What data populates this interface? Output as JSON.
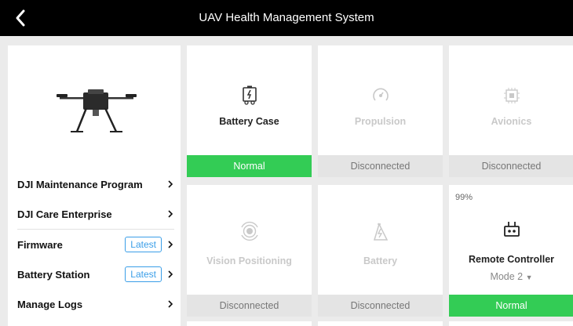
{
  "header": {
    "title": "UAV Health Management System",
    "back_icon": "chevron-left-icon"
  },
  "sidebar": {
    "items": [
      {
        "label": "DJI Maintenance Program"
      },
      {
        "label": "DJI Care Enterprise"
      },
      {
        "label": "Firmware",
        "badge": "Latest"
      },
      {
        "label": "Battery Station",
        "badge": "Latest"
      },
      {
        "label": "Manage Logs"
      }
    ]
  },
  "modules": [
    {
      "name": "Battery Case",
      "status": "Normal",
      "icon": "battery-case-icon"
    },
    {
      "name": "Propulsion",
      "status": "Disconnected",
      "icon": "propulsion-icon"
    },
    {
      "name": "Avionics",
      "status": "Disconnected",
      "icon": "avionics-icon"
    },
    {
      "name": "Vision Positioning",
      "status": "Disconnected",
      "icon": "vision-positioning-icon"
    },
    {
      "name": "Battery",
      "status": "Disconnected",
      "icon": "battery-icon"
    },
    {
      "name": "Remote Controller",
      "status": "Normal",
      "percent": "99%",
      "mode": "Mode 2",
      "icon": "remote-controller-icon"
    }
  ],
  "colors": {
    "normal": "#33cc55",
    "disconnected_bg": "#e4e4e4",
    "badge": "#3a9ee8"
  }
}
